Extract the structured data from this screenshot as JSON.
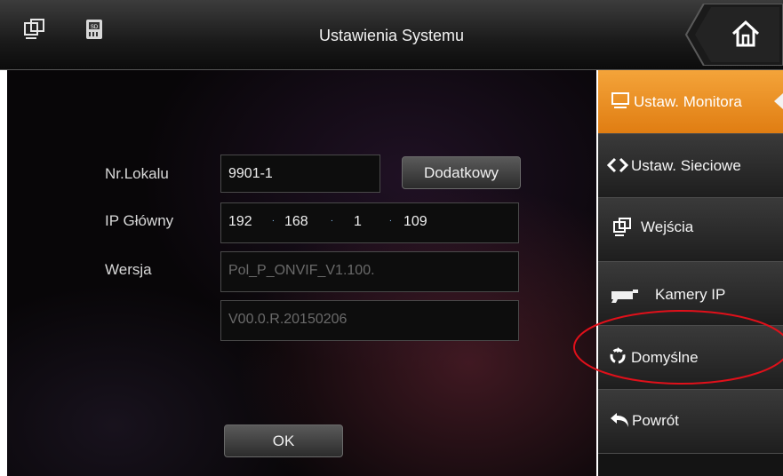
{
  "header": {
    "title": "Ustawienia Systemu",
    "icons": [
      "monitor-icon",
      "sd-card-icon",
      "home-icon"
    ]
  },
  "form": {
    "room_label": "Nr.Lokalu",
    "room_value": "9901-1",
    "extra_button": "Dodatkowy",
    "ip_label": "IP Główny",
    "ip_octets": [
      "192",
      "168",
      "1",
      "109"
    ],
    "version_label": "Wersja",
    "version_line1": "Pol_P_ONVIF_V1.100.",
    "version_line2": "V00.0.R.20150206",
    "ok_button": "OK"
  },
  "sidebar": {
    "items": [
      {
        "label": "Ustaw. Monitora",
        "icon": "monitor-icon",
        "active": true
      },
      {
        "label": "Ustaw. Sieciowe",
        "icon": "network-arrows-icon",
        "active": false
      },
      {
        "label": "Wejścia",
        "icon": "inputs-icon",
        "active": false
      },
      {
        "label": "Kamery IP",
        "icon": "camera-icon",
        "active": false
      },
      {
        "label": "Domyślne",
        "icon": "recycle-icon",
        "active": false
      },
      {
        "label": "Powrót",
        "icon": "back-arrow-icon",
        "active": false
      }
    ]
  },
  "annotation": {
    "color": "#e0101a",
    "target": "Domyślne"
  },
  "colors": {
    "accent": "#f39a2a",
    "background": "#080608"
  }
}
